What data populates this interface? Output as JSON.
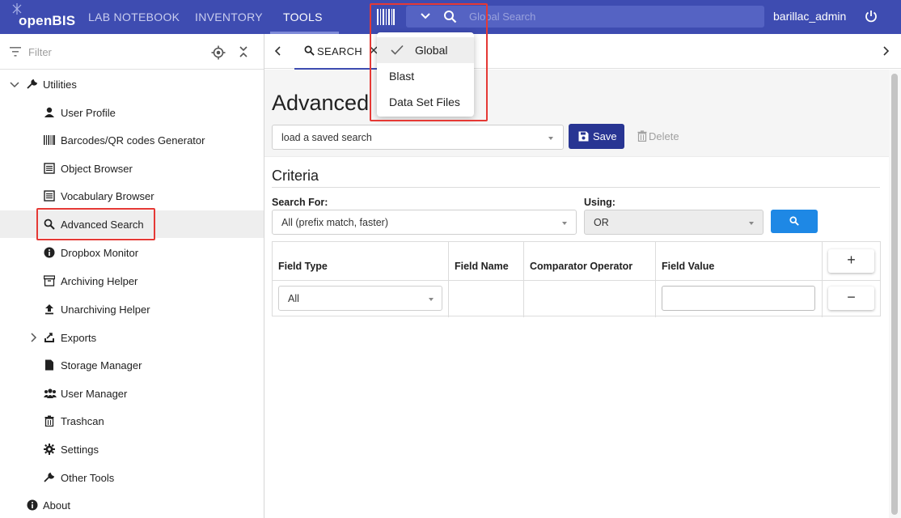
{
  "topbar": {
    "logo_text": "openBIS",
    "nav": [
      {
        "label": "LAB NOTEBOOK"
      },
      {
        "label": "INVENTORY"
      },
      {
        "label": "TOOLS"
      }
    ],
    "search_placeholder": "Global Search",
    "username": "barillac_admin",
    "bg_color": "#3e4cb1"
  },
  "search_dropdown": {
    "options": [
      {
        "label": "Global"
      },
      {
        "label": "Blast"
      },
      {
        "label": "Data Set Files"
      }
    ],
    "selected": "Global"
  },
  "sidebar": {
    "filter_placeholder": "Filter",
    "items": [
      {
        "label": "Utilities",
        "icon": "wrench-icon"
      },
      {
        "label": "User Profile",
        "icon": "person-icon"
      },
      {
        "label": "Barcodes/QR codes Generator",
        "icon": "barcode-icon"
      },
      {
        "label": "Object Browser",
        "icon": "list-icon"
      },
      {
        "label": "Vocabulary Browser",
        "icon": "list-icon"
      },
      {
        "label": "Advanced Search",
        "icon": "search-icon"
      },
      {
        "label": "Dropbox Monitor",
        "icon": "info-icon"
      },
      {
        "label": "Archiving Helper",
        "icon": "archive-icon"
      },
      {
        "label": "Unarchiving Helper",
        "icon": "upload-icon"
      },
      {
        "label": "Exports",
        "icon": "export-icon"
      },
      {
        "label": "Storage Manager",
        "icon": "file-icon"
      },
      {
        "label": "User Manager",
        "icon": "users-icon"
      },
      {
        "label": "Trashcan",
        "icon": "trash-icon"
      },
      {
        "label": "Settings",
        "icon": "gear-icon"
      },
      {
        "label": "Other Tools",
        "icon": "wrench-icon"
      },
      {
        "label": "About",
        "icon": "info-icon"
      }
    ]
  },
  "tabs": {
    "search_tab_label": "SEARCH"
  },
  "main": {
    "title": "Advanced",
    "saved_search_placeholder": "load a saved search",
    "save_label": "Save",
    "delete_label": "Delete",
    "criteria_title": "Criteria",
    "search_for_label": "Search For:",
    "search_for_value": "All (prefix match, faster)",
    "using_label": "Using:",
    "using_value": "OR",
    "table": {
      "headers": [
        "Field Type",
        "Field Name",
        "Comparator Operator",
        "Field Value"
      ],
      "add_label": "+",
      "remove_label": "−",
      "row_field_type": "All"
    }
  }
}
